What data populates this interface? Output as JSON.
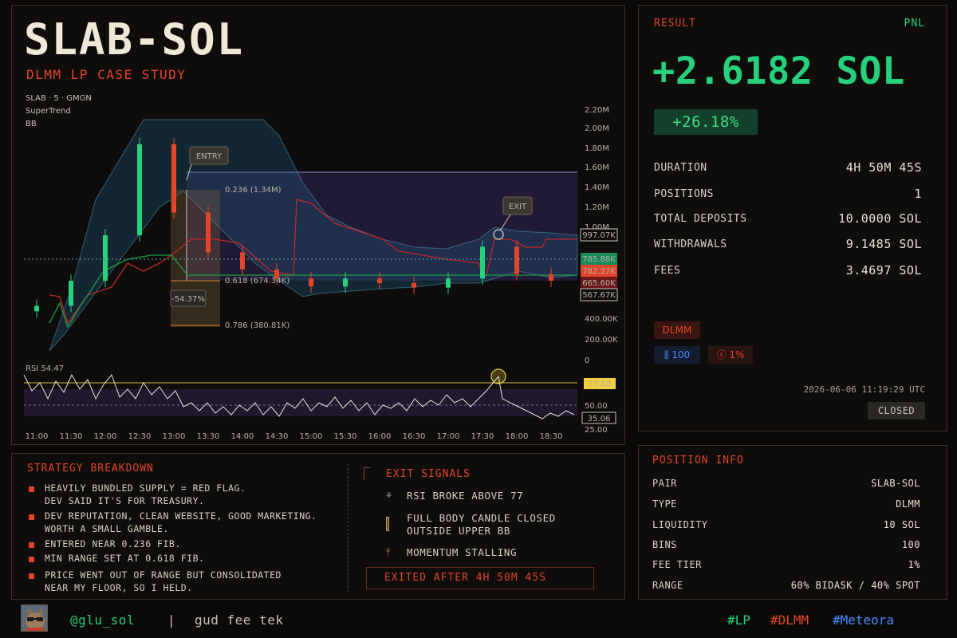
{
  "header": {
    "title": "SLAB-SOL",
    "subtitle": "DLMM LP CASE STUDY"
  },
  "chart": {
    "legend": [
      "SLAB · 5 · GMGN",
      "SuperTrend",
      "BB"
    ],
    "annotations": {
      "entry": "ENTRY",
      "exit": "EXIT",
      "fib_0236": "0.236 (1.34M)",
      "fib_0618": "0.618 (674.34K)",
      "fib_0786": "0.786 (380.81K)",
      "drawdown": "-54.37%"
    },
    "price_axis": [
      "2.20M",
      "2.00M",
      "1.80M",
      "1.60M",
      "1.40M",
      "1.20M",
      "1.00M",
      "400.00K",
      "200.00K",
      "0"
    ],
    "price_badges": {
      "b1": "997.07K",
      "b2": "785.88K",
      "b3": "782.37K",
      "b4": "665.60K",
      "b5": "567.67K"
    },
    "rsi_label": "RSI 54.47",
    "rsi_axis": [
      "50.00",
      "25.00"
    ],
    "rsi_badges": {
      "high": "77.88",
      "current": "35.06"
    },
    "time_axis": [
      "11:00",
      "11:30",
      "12:00",
      "12:30",
      "13:00",
      "13:30",
      "14:00",
      "14:30",
      "15:00",
      "15:30",
      "16:00",
      "16:30",
      "17:00",
      "17:30",
      "18:00",
      "18:30"
    ]
  },
  "chart_data": {
    "type": "line",
    "title": "SLAB · 5 · GMGN",
    "ylabel": "",
    "ylim": [
      0,
      2200000
    ],
    "x": [
      "11:00",
      "11:30",
      "12:00",
      "12:30",
      "13:00",
      "13:30",
      "14:00",
      "14:30",
      "15:00",
      "15:30",
      "16:00",
      "16:30",
      "17:00",
      "17:30",
      "18:00",
      "18:30"
    ],
    "series": [
      {
        "values": [
          480000,
          700000,
          1100000,
          1900000,
          1300000,
          950000,
          800000,
          720000,
          650000,
          720000,
          680000,
          640000,
          720000,
          1000000,
          760000,
          700000
        ]
      }
    ]
  },
  "result": {
    "label": "RESULT",
    "pnl_label": "PNL",
    "pnl_value": "+2.6182 SOL",
    "pnl_pct": "+26.18%",
    "rows": [
      {
        "key": "DURATION",
        "value": "4H 50M 45S"
      },
      {
        "key": "POSITIONS",
        "value": "1"
      },
      {
        "key": "TOTAL DEPOSITS",
        "value": "10.0000 SOL"
      },
      {
        "key": "WITHDRAWALS",
        "value": "9.1485 SOL"
      },
      {
        "key": "FEES",
        "value": "3.4697 SOL"
      }
    ],
    "tag": "DLMM",
    "bins_chip": "100",
    "fee_chip": "1%",
    "timestamp": "2026-06-06 11:19:29 UTC",
    "status": "CLOSED"
  },
  "position_info": {
    "title": "POSITION INFO",
    "rows": [
      {
        "key": "PAIR",
        "value": "SLAB-SOL"
      },
      {
        "key": "TYPE",
        "value": "DLMM"
      },
      {
        "key": "LIQUIDITY",
        "value": "10 SOL"
      },
      {
        "key": "BINS",
        "value": "100"
      },
      {
        "key": "FEE TIER",
        "value": "1%"
      },
      {
        "key": "RANGE",
        "value": "60% BIDASK / 40% SPOT"
      }
    ]
  },
  "strategy": {
    "title": "STRATEGY BREAKDOWN",
    "items": [
      "HEAVILY BUNDLED SUPPLY = RED FLAG.\nDEV SAID IT'S FOR TREASURY.",
      "DEV REPUTATION, CLEAN WEBSITE, GOOD MARKETING.\nWORTH A SMALL GAMBLE.",
      "ENTERED NEAR 0.236 FIB.",
      "MIN RANGE SET AT 0.618 FIB.",
      "PRICE WENT OUT OF RANGE BUT CONSOLIDATED\nNEAR MY FLOOR, SO I HELD."
    ]
  },
  "exit_signals": {
    "title": "EXIT SIGNALS",
    "items": [
      "RSI BROKE ABOVE 77",
      "FULL BODY CANDLE CLOSED\nOUTSIDE UPPER BB",
      "MOMENTUM STALLING"
    ],
    "summary": "EXITED AFTER 4H 50M 45S"
  },
  "footer": {
    "handle": "@glu_sol",
    "separator": "|",
    "tagline": "gud fee tek",
    "tags": [
      "#LP",
      "#DLMM",
      "#Meteora"
    ]
  },
  "colors": {
    "accent": "#e2452a",
    "profit": "#27d07a",
    "blue": "#3a7bff",
    "yellow": "#f0d040"
  }
}
